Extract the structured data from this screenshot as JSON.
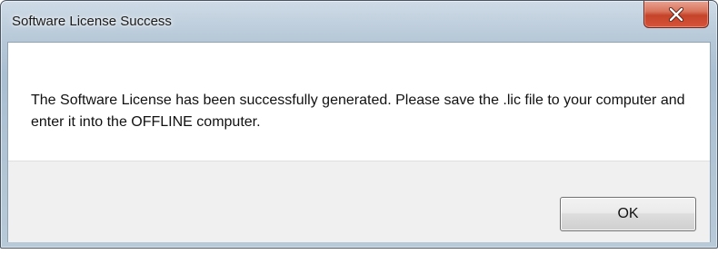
{
  "window": {
    "title": "Software License Success",
    "close_icon": "close-icon"
  },
  "dialog": {
    "message": "The Software License has been successfully generated. Please save the .lic file to your computer and enter it into the OFFLINE computer.",
    "ok_label": "OK"
  },
  "colors": {
    "titlebar": "#b9cad9",
    "close_button": "#c4442a",
    "footer": "#f0f0f0"
  }
}
